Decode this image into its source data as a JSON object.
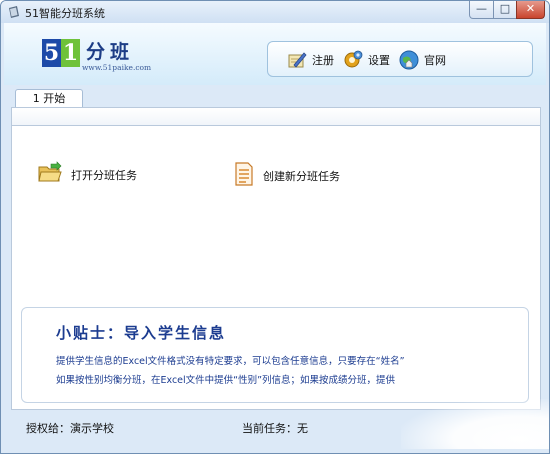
{
  "window": {
    "title": "51智能分班系统",
    "controls": {
      "minimize": "—",
      "maximize": "□",
      "close": "✕"
    }
  },
  "header": {
    "logo": {
      "digit1": "5",
      "digit2": "1",
      "name": "分班",
      "url": "www.51paike.com"
    },
    "toolbar": [
      {
        "label": "注册",
        "icon": "register-pen-icon"
      },
      {
        "label": "设置",
        "icon": "settings-gear-icon"
      },
      {
        "label": "官网",
        "icon": "globe-home-icon"
      }
    ]
  },
  "tabs": [
    {
      "label": "1 开始",
      "active": true
    }
  ],
  "actions": {
    "open": {
      "label": "打开分班任务",
      "icon": "open-folder-icon"
    },
    "new": {
      "label": "创建新分班任务",
      "icon": "new-document-icon"
    }
  },
  "tips": {
    "title": "小贴士：导入学生信息",
    "lines": [
      "提供学生信息的Excel文件格式没有特定要求，可以包含任意信息，只要存在“姓名”",
      "如果按性别均衡分班，在Excel文件中提供“性别”列信息；如果按成绩分班，提供"
    ]
  },
  "status": {
    "license": "授权给：演示学校",
    "task": "当前任务：无"
  },
  "colors": {
    "accent": "#1c3c90",
    "logo_blue": "#1d4aa8",
    "logo_green": "#6fc23a",
    "frame": "#dce9f7"
  }
}
